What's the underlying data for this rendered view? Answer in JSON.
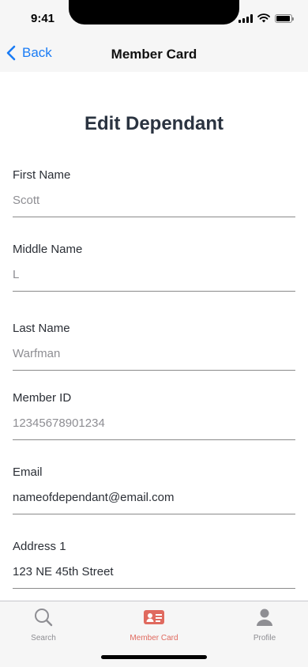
{
  "status": {
    "time": "9:41"
  },
  "nav": {
    "back_label": "Back",
    "title": "Member Card"
  },
  "page": {
    "heading": "Edit Dependant"
  },
  "fields": [
    {
      "label": "First Name",
      "value": "Scott"
    },
    {
      "label": "Middle Name",
      "value": "L"
    },
    {
      "label": "Last Name",
      "value": "Warfman"
    },
    {
      "label": "Member ID",
      "value": "12345678901234"
    },
    {
      "label": "Email",
      "value": "nameofdependant@email.com"
    },
    {
      "label": "Address 1",
      "value": "123 NE 45th Street"
    }
  ],
  "tabs": [
    {
      "label": "Search",
      "icon": "search-icon"
    },
    {
      "label": "Member Card",
      "icon": "member-card-icon",
      "active": true
    },
    {
      "label": "Profile",
      "icon": "profile-icon"
    }
  ],
  "colors": {
    "accent": "#1a7cf5",
    "active_tab": "#e06a5f",
    "heading": "#2a3340"
  }
}
